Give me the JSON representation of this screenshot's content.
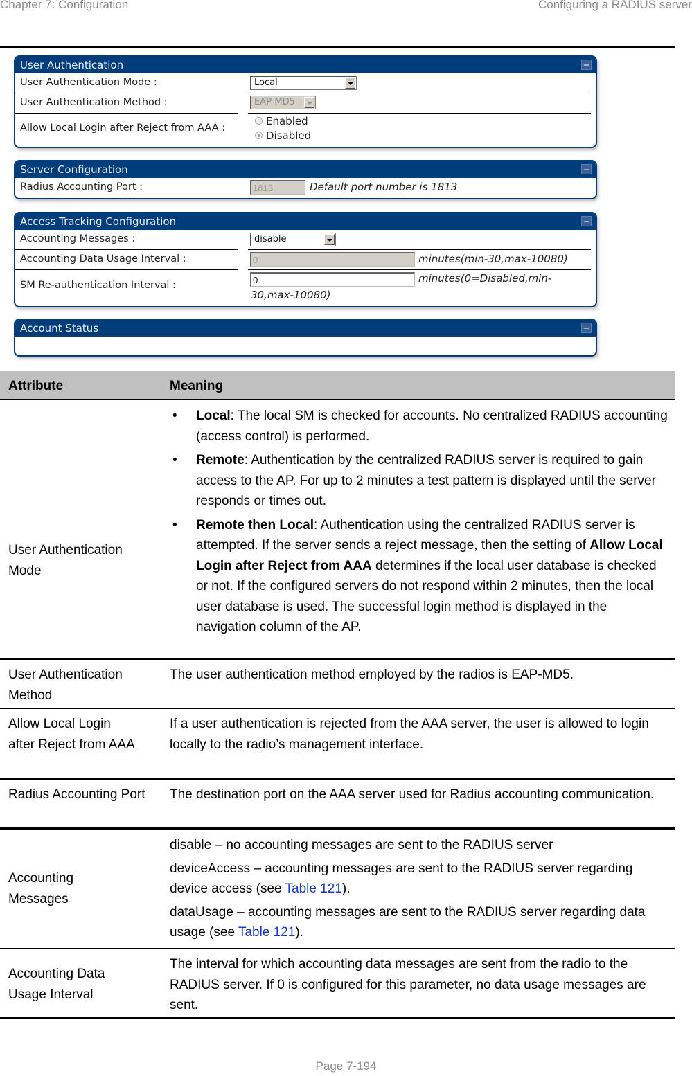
{
  "header": {
    "chapter": "Chapter 7:  Configuration",
    "section": "Configuring a RADIUS server"
  },
  "panels": {
    "user_auth": {
      "title": "User Authentication",
      "mode_label": "User Authentication Mode :",
      "mode_value": "Local",
      "method_label": "User Authentication Method :",
      "method_value": "EAP-MD5",
      "allow_label": "Allow Local Login after Reject from AAA :",
      "allow_options": [
        "Enabled",
        "Disabled"
      ],
      "allow_selected": "Disabled"
    },
    "server_config": {
      "title": "Server Configuration",
      "port_label": "Radius Accounting Port :",
      "port_value": "1813",
      "port_hint": "Default port number is 1813"
    },
    "access_tracking": {
      "title": "Access Tracking Configuration",
      "messages_label": "Accounting Messages :",
      "messages_value": "disable",
      "usage_label": "Accounting Data Usage Interval :",
      "usage_value": "0",
      "usage_hint": "minutes(min-30,max-10080)",
      "reauth_label": "SM Re-authentication Interval :",
      "reauth_value": "0",
      "reauth_hint_line1": "minutes(0=Disabled,min-",
      "reauth_hint_line2": "30,max-10080)"
    },
    "account_status": {
      "title": "Account Status"
    }
  },
  "table": {
    "headers": [
      "Attribute",
      "Meaning"
    ],
    "rows": [
      {
        "attribute": "User Authentication Mode",
        "bullets": [
          {
            "term": "Local",
            "text": ": The local SM is checked for accounts. No centralized RADIUS accounting (access control) is performed."
          },
          {
            "term": "Remote",
            "text": ": Authentication by the centralized RADIUS server is required to gain access to the AP. For up to 2 minutes a test pattern is displayed until the server responds or times out."
          },
          {
            "term": "Remote then Local",
            "text": ": Authentication using the centralized RADIUS server is attempted. If the server sends a reject message, then the setting of ",
            "term2": "Allow Local Login after Reject from AAA",
            "text2": " determines if the local user database is checked or not. If the configured servers do not respond within 2 minutes, then the local user database is used. The successful login method is displayed in the navigation column of the AP."
          }
        ]
      },
      {
        "attribute": "User Authentication Method",
        "meaning": "The user authentication method employed by the radios is EAP-MD5."
      },
      {
        "attribute": "Allow Local Login after Reject from AAA",
        "meaning": "If a user authentication is rejected from the AAA server, the user is allowed to login locally to the radio’s management interface."
      },
      {
        "attribute": "Radius Accounting Port",
        "meaning": "The destination port on the AAA server used for Radius accounting communication."
      },
      {
        "attribute": "Accounting Messages",
        "paras": [
          {
            "text": "disable – no accounting messages are sent to the RADIUS server"
          },
          {
            "text": "deviceAccess – accounting messages are sent to the RADIUS server regarding device access (see ",
            "link": "Table 121",
            "tail": ")."
          },
          {
            "text": "dataUsage – accounting messages are sent to the RADIUS server regarding data usage (see ",
            "link": "Table 121",
            "tail": ")."
          }
        ]
      },
      {
        "attribute": "Accounting Data Usage Interval",
        "meaning": "The interval for which accounting data messages are sent from the radio to the RADIUS server.  If  0 is configured for this parameter, no data usage messages are sent."
      }
    ]
  },
  "footer": {
    "page": "Page 7-194"
  },
  "colors": {
    "panel_title_bg": "#003d7a",
    "table_header_bg": "#c0c0c0",
    "link": "#1a39c9"
  }
}
